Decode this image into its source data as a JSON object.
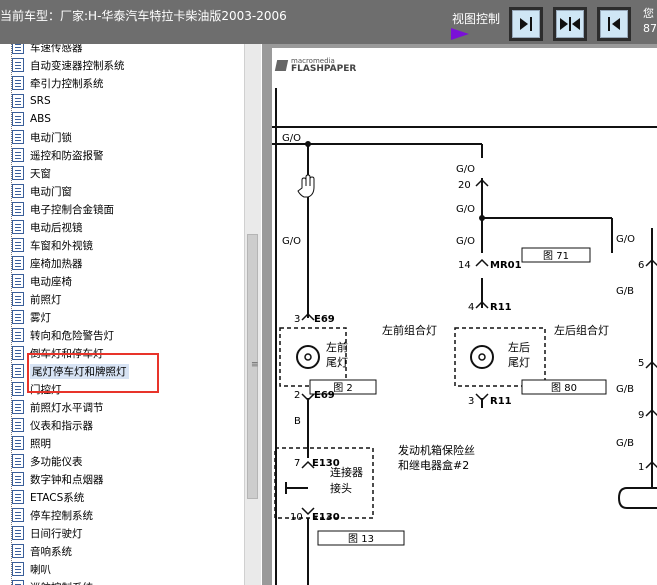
{
  "header": {
    "title": "当前车型：厂家:H-华泰汽车特拉卡柴油版2003-2006",
    "view_control_label": "视图控制",
    "corner_text": [
      "您",
      "87"
    ]
  },
  "tree": {
    "items": [
      "车速传感器",
      "自动变速器控制系统",
      "牵引力控制系统",
      "SRS",
      "ABS",
      "电动门锁",
      "遥控和防盗报警",
      "天窗",
      "电动门窗",
      "电子控制合金镜面",
      "电动后视镜",
      "车窗和外视镜",
      "座椅加热器",
      "电动座椅",
      "前照灯",
      "雾灯",
      "转向和危险警告灯",
      "倒车灯和停车灯",
      "尾灯停车灯和牌照灯",
      "门控灯",
      "前照灯水平调节",
      "仪表和指示器",
      "照明",
      "多功能仪表",
      "数字钟和点烟器",
      "ETACS系统",
      "停车控制系统",
      "日间行驶灯",
      "音响系统",
      "喇叭",
      "巡航控制系统"
    ],
    "selected_index": 18
  },
  "viewer": {
    "logo_line1": "macromedia",
    "logo_line2": "FLASHPAPER"
  },
  "diagram": {
    "wire_labels": {
      "go_top_left": "G/O",
      "go_left_2": "G/O",
      "b_left": "B",
      "go_mid_1": "G/O",
      "go_mid_2": "G/O",
      "go_mid_3": "G/O",
      "go_right_1": "G/O",
      "gb_right_1": "G/B",
      "gb_right_2": "G/B",
      "gb_right_3": "G/B"
    },
    "pins": {
      "pin_20": "20",
      "pin_14": "14",
      "pin_4": "4",
      "pin_3_mid": "3",
      "pin_3_left": "3",
      "pin_2_left": "2",
      "pin_7": "7",
      "pin_10": "10",
      "pin_6": "6",
      "pin_5": "5",
      "pin_9": "9",
      "pin_1": "1"
    },
    "connectors": {
      "e69_top": "E69",
      "e69_bottom": "E69",
      "mr01": "MR01",
      "r11_top": "R11",
      "r11_bottom": "R11",
      "e130_top": "E130",
      "e130_bottom": "E130"
    },
    "components": {
      "left_front_combo": "左前组合灯",
      "left_front_tail_1": "左前",
      "left_front_tail_2": "尾灯",
      "left_rear_combo": "左后组合灯",
      "left_rear_tail_1": "左后",
      "left_rear_tail_2": "尾灯",
      "connector_1": "连接器",
      "connector_2": "接头",
      "engine_fuse_1": "发动机箱保险丝",
      "engine_fuse_2": "和继电器盒#2"
    },
    "figure_refs": {
      "fig_71": "图 71",
      "fig_2": "图 2",
      "fig_80": "图 80",
      "fig_13": "图 13"
    }
  }
}
